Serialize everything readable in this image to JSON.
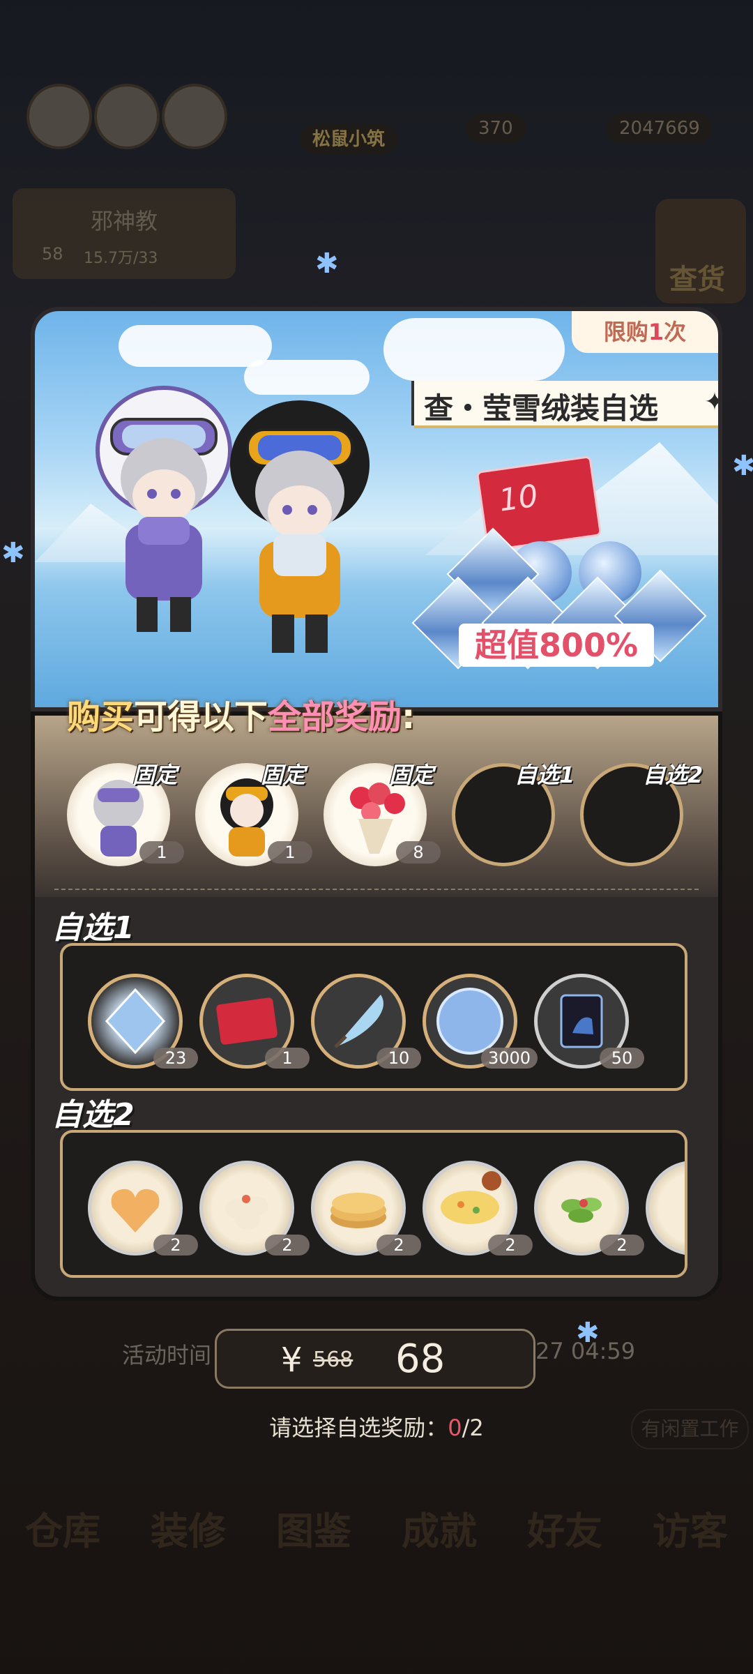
{
  "background": {
    "nav_icons": [
      "back-icon",
      "home-icon",
      "help-icon"
    ],
    "stat_1": "370",
    "stat_2": "2047669",
    "shop_name_badge": "松鼠小筑",
    "player_name": "邪神教",
    "player_level": "58",
    "player_gold": "15.7万/33",
    "shop_label": "查货",
    "work_button": "有闲置工作",
    "bottom_nav": [
      "仓库",
      "装修",
      "图鉴",
      "成就",
      "好友",
      "访客"
    ]
  },
  "banner": {
    "limit_prefix": "限购",
    "limit_count": "1",
    "limit_suffix": "次",
    "title": "查・莹雪绒装自选",
    "title_star": "✦",
    "bonus": "超值800%"
  },
  "rewards": {
    "headline_a": "购买",
    "headline_b": "可得以下",
    "headline_c": "全部奖励",
    "headline_d": ":",
    "fixed": [
      {
        "label": "固定",
        "qty": "1",
        "icon": "costume-purple-icon"
      },
      {
        "label": "固定",
        "qty": "1",
        "icon": "costume-black-icon"
      },
      {
        "label": "固定",
        "qty": "8",
        "icon": "bouquet-icon"
      }
    ],
    "choice_slots": [
      {
        "label": "自选1"
      },
      {
        "label": "自选2"
      }
    ]
  },
  "choice1": {
    "title": "自选1",
    "items": [
      {
        "qty": "23",
        "icon": "diamond-gem-icon"
      },
      {
        "qty": "1",
        "icon": "red-card-icon"
      },
      {
        "qty": "10",
        "icon": "quill-pen-icon"
      },
      {
        "qty": "3000",
        "icon": "blue-coin-icon"
      },
      {
        "qty": "50",
        "icon": "love-box-icon"
      }
    ]
  },
  "choice2": {
    "title": "自选2",
    "items": [
      {
        "qty": "2",
        "icon": "heart-pie-icon"
      },
      {
        "qty": "2",
        "icon": "dumpling-plate-icon"
      },
      {
        "qty": "2",
        "icon": "pancake-stack-icon"
      },
      {
        "qty": "2",
        "icon": "soup-bowl-icon"
      },
      {
        "qty": "2",
        "icon": "salad-plate-icon"
      }
    ]
  },
  "purchase": {
    "currency": "¥",
    "old_price": "568",
    "new_price": "68",
    "event_time_label": "活动时间",
    "event_time_end": "27 04:59"
  },
  "hint": {
    "text": "请选择自选奖励：",
    "current": "0",
    "total": "/2"
  },
  "colors": {
    "accent_pink": "#ff8fb4",
    "accent_red": "#e3506a",
    "gold_border": "#c9a878"
  }
}
